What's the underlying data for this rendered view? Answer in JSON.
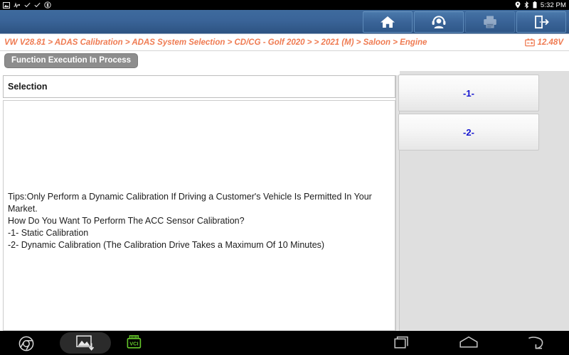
{
  "status_bar": {
    "icons": [
      "screenshot-icon",
      "usb-pulse-icon",
      "check-icon",
      "check-icon",
      "bluetooth-circle-icon"
    ],
    "location_icon": "location-pin-icon",
    "bluetooth_icon": "bluetooth-icon",
    "battery_icon": "battery-icon",
    "time": "5:32 PM"
  },
  "toolbar": {
    "home_label": "home-icon",
    "support_label": "headset-icon",
    "print_label": "printer-icon",
    "exit_label": "exit-icon",
    "accent_color": "#3a6498"
  },
  "breadcrumb": {
    "text": "VW V28.81 > ADAS Calibration > ADAS System Selection  > CD/CG - Golf 2020 > > 2021 (M) > Saloon > Engine",
    "color": "#ef7b52"
  },
  "voltage": {
    "icon": "battery-icon",
    "value": "12.48V"
  },
  "status_badge": {
    "text": "Function Execution In Process",
    "background": "#8d8d8d"
  },
  "selection_panel": {
    "column_header": "Selection",
    "lines": [
      "Tips:Only Perform a Dynamic Calibration If Driving a Customer's Vehicle Is Permitted In Your",
      "Market.",
      "How Do You Want To Perform The ACC Sensor Calibration?",
      "-1- Static Calibration",
      "-2- Dynamic Calibration (The Calibration Drive Takes a Maximum Of 10 Minutes)"
    ]
  },
  "options": {
    "buttons": [
      {
        "label": "-1-",
        "color": "#1414cf"
      },
      {
        "label": "-2-",
        "color": "#1414cf"
      }
    ]
  },
  "bottom_nav": {
    "chrome_icon": "chrome-icon",
    "screenshot_icon": "screenshot-capture-icon",
    "vci_label": "VCI",
    "recents_icon": "recents-icon",
    "home_icon": "home-icon",
    "back_icon": "back-icon"
  }
}
